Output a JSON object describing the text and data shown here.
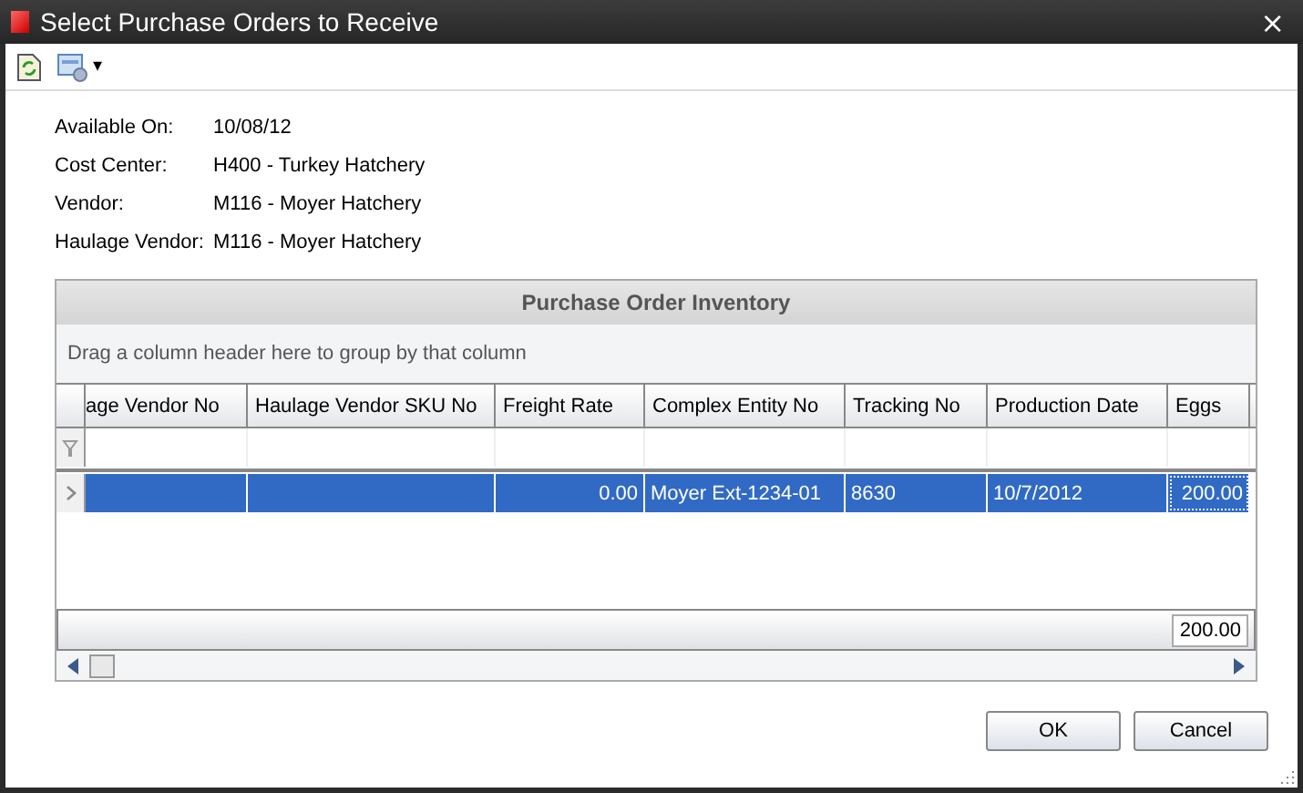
{
  "window": {
    "title": "Select Purchase Orders to Receive",
    "close": "×"
  },
  "toolbar": {
    "dropdown": "▾"
  },
  "fields": [
    {
      "label": "Available On:",
      "value": "10/08/12"
    },
    {
      "label": "Cost Center:",
      "value": "H400 - Turkey Hatchery"
    },
    {
      "label": "Vendor:",
      "value": "M116 - Moyer Hatchery"
    },
    {
      "label": "Haulage Vendor:",
      "value": "M116 - Moyer Hatchery"
    }
  ],
  "grid": {
    "title": "Purchase Order Inventory",
    "group_hint": "Drag a column header here to group by that column",
    "columns": [
      {
        "label": "age Vendor No",
        "kind": "text"
      },
      {
        "label": "Haulage Vendor SKU No",
        "kind": "text"
      },
      {
        "label": "Freight Rate",
        "kind": "number"
      },
      {
        "label": "Complex Entity No",
        "kind": "text"
      },
      {
        "label": "Tracking No",
        "kind": "text"
      },
      {
        "label": "Production Date",
        "kind": "text"
      },
      {
        "label": "Eggs",
        "kind": "number"
      }
    ],
    "rows": [
      {
        "selected": true,
        "cells": [
          "",
          "",
          "0.00",
          "Moyer Ext-1234-01",
          "8630",
          "10/7/2012",
          "200.00"
        ]
      }
    ],
    "footer_total": "200.00"
  },
  "buttons": [
    "OK",
    "Cancel"
  ]
}
